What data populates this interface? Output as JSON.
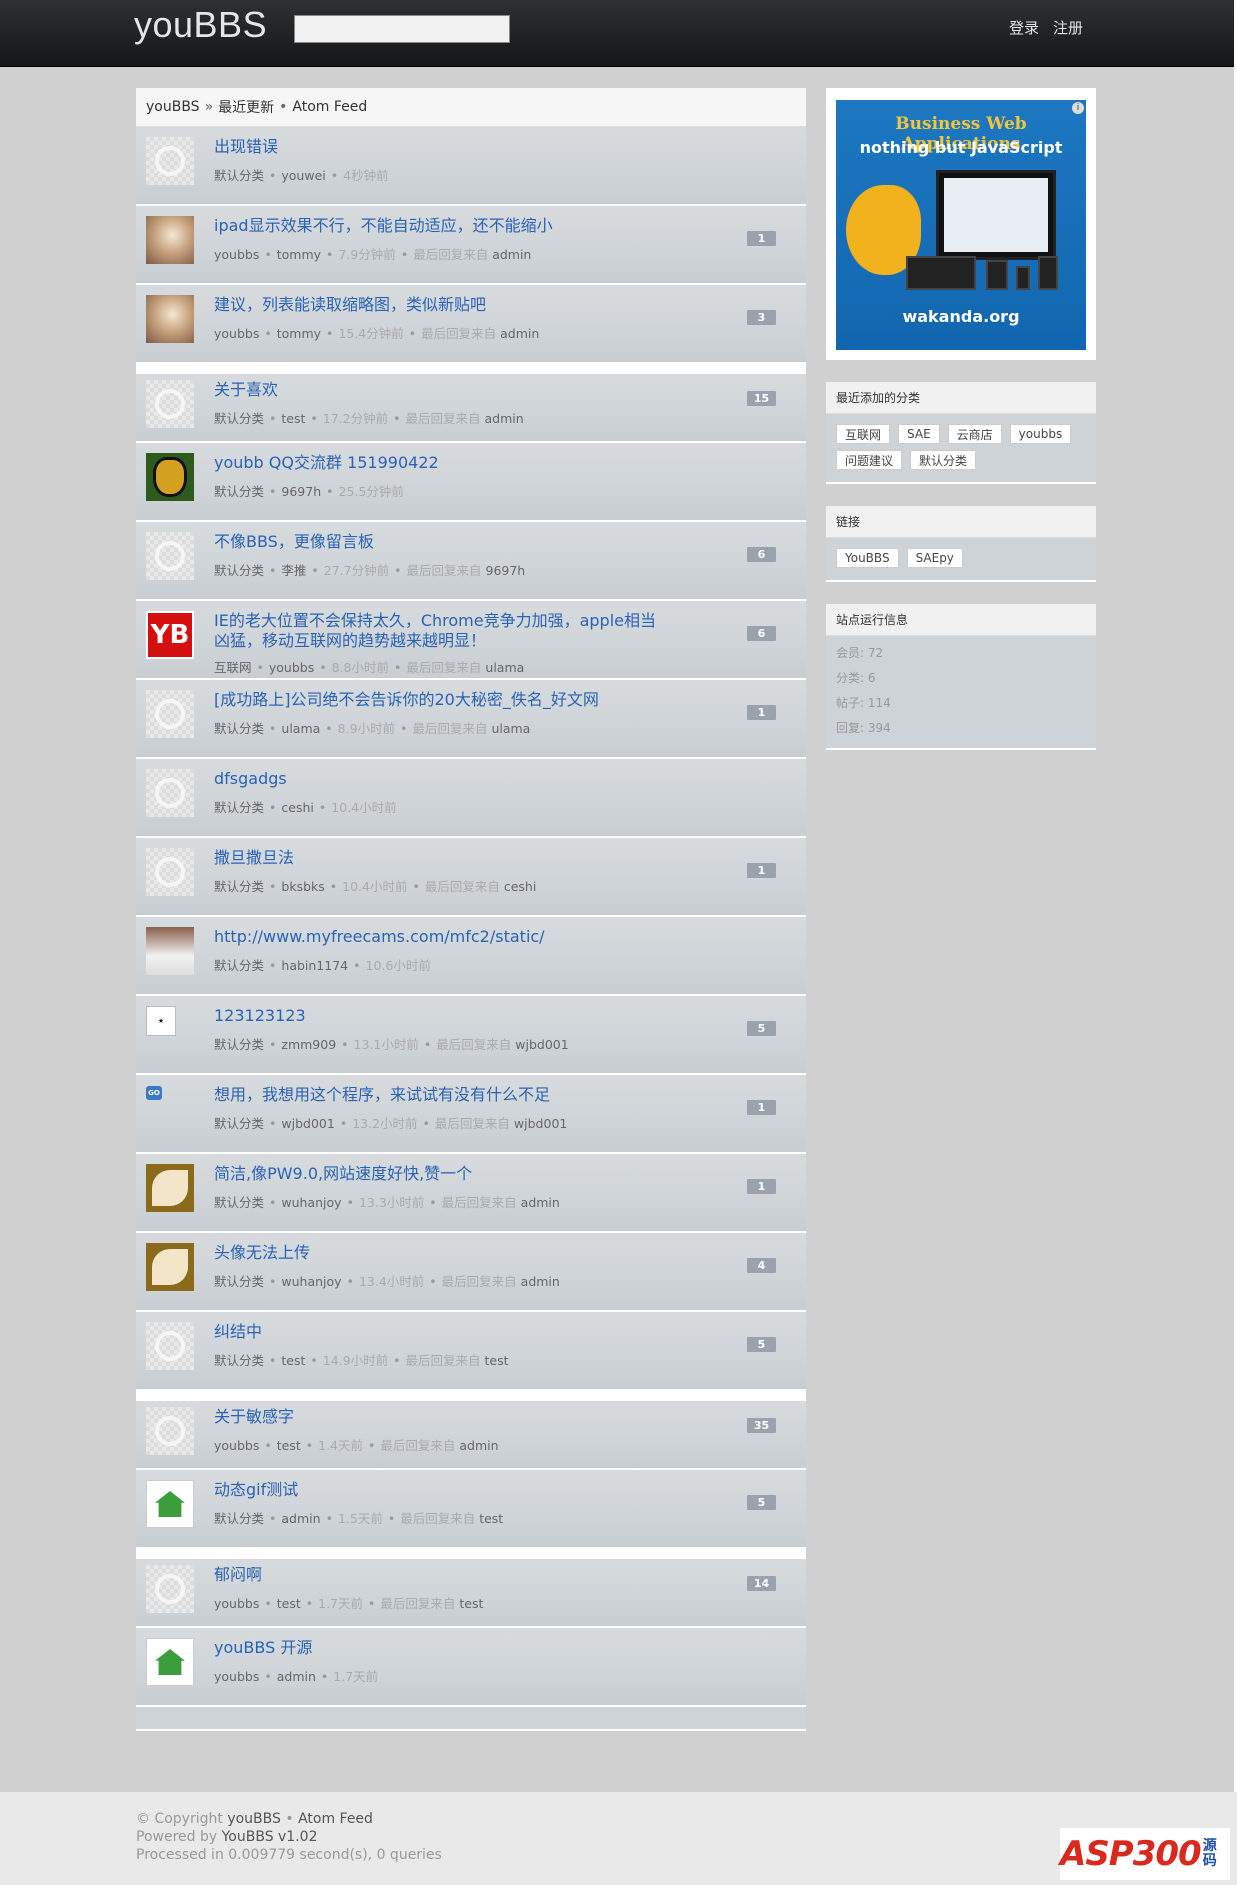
{
  "header": {
    "logo": "youBBS",
    "nav": [
      "登录",
      "注册"
    ]
  },
  "breadcrumb": {
    "home": "youBBS",
    "separator": "»",
    "current": "最近更新",
    "bullet": "•",
    "feed": "Atom Feed"
  },
  "labels": {
    "last_reply": "最后回复来自"
  },
  "topics": [
    {
      "title": "出现错误",
      "category": "默认分类",
      "author": "youwei",
      "time": "4秒钟前",
      "avatar": "default"
    },
    {
      "title": "ipad显示效果不行，不能自动适应，还不能缩小",
      "category": "youbbs",
      "author": "tommy",
      "time": "7.9分钟前",
      "last_reply": "admin",
      "count": "1",
      "avatar": "photo"
    },
    {
      "title": "建议，列表能读取缩略图，类似新贴吧",
      "category": "youbbs",
      "author": "tommy",
      "time": "15.4分钟前",
      "last_reply": "admin",
      "count": "3",
      "avatar": "photo"
    },
    {
      "title": "关于喜欢",
      "category": "默认分类",
      "author": "test",
      "time": "17.2分钟前",
      "last_reply": "admin",
      "count": "15",
      "avatar": "default",
      "sticky": true
    },
    {
      "title": "youbb QQ交流群 151990422",
      "category": "默认分类",
      "author": "9697h",
      "time": "25.5分钟前",
      "avatar": "face"
    },
    {
      "title": "不像BBS，更像留言板",
      "category": "默认分类",
      "author": "李推",
      "time": "27.7分钟前",
      "last_reply": "9697h",
      "count": "6",
      "avatar": "default"
    },
    {
      "title": "IE的老大位置不会保持太久，Chrome竞争力加强，apple相当凶猛，移动互联网的趋势越来越明显！",
      "category": "互联网",
      "author": "youbbs",
      "time": "8.8小时前",
      "last_reply": "ulama",
      "count": "6",
      "avatar": "yb",
      "twoline": true
    },
    {
      "title": "[成功路上]公司绝不会告诉你的20大秘密_佚名_好文网",
      "category": "默认分类",
      "author": "ulama",
      "time": "8.9小时前",
      "last_reply": "ulama",
      "count": "1",
      "avatar": "default"
    },
    {
      "title": "dfsgadgs",
      "category": "默认分类",
      "author": "ceshi",
      "time": "10.4小时前",
      "avatar": "default"
    },
    {
      "title": "撒旦撒旦法",
      "category": "默认分类",
      "author": "bksbks",
      "time": "10.4小时前",
      "last_reply": "ceshi",
      "count": "1",
      "avatar": "default"
    },
    {
      "title": "http://www.myfreecams.com/mfc2/static/",
      "category": "默认分类",
      "author": "habin1174",
      "time": "10.6小时前",
      "avatar": "bust"
    },
    {
      "title": "123123123",
      "category": "默认分类",
      "author": "zmm909",
      "time": "13.1小时前",
      "last_reply": "wjbd001",
      "count": "5",
      "avatar": "small"
    },
    {
      "title": "想用，我想用这个程序，来试试有没有什么不足",
      "category": "默认分类",
      "author": "wjbd001",
      "time": "13.2小时前",
      "last_reply": "wjbd001",
      "count": "1",
      "avatar": "go"
    },
    {
      "title": "简洁,像PW9.0,网站速度好快,赞一个",
      "category": "默认分类",
      "author": "wuhanjoy",
      "time": "13.3小时前",
      "last_reply": "admin",
      "count": "1",
      "avatar": "leaf"
    },
    {
      "title": "头像无法上传",
      "category": "默认分类",
      "author": "wuhanjoy",
      "time": "13.4小时前",
      "last_reply": "admin",
      "count": "4",
      "avatar": "leaf"
    },
    {
      "title": "纠结中",
      "category": "默认分类",
      "author": "test",
      "time": "14.9小时前",
      "last_reply": "test",
      "count": "5",
      "avatar": "default"
    },
    {
      "title": "关于敏感字",
      "category": "youbbs",
      "author": "test",
      "time": "1.4天前",
      "last_reply": "admin",
      "count": "35",
      "avatar": "default",
      "sticky": true
    },
    {
      "title": "动态gif测试",
      "category": "默认分类",
      "author": "admin",
      "time": "1.5天前",
      "last_reply": "test",
      "count": "5",
      "avatar": "house"
    },
    {
      "title": "郁闷啊",
      "category": "youbbs",
      "author": "test",
      "time": "1.7天前",
      "last_reply": "test",
      "count": "14",
      "avatar": "default",
      "sticky": true
    },
    {
      "title": "youBBS 开源",
      "category": "youbbs",
      "author": "admin",
      "time": "1.7天前",
      "avatar": "house"
    }
  ],
  "ad": {
    "line1": "Business Web Applications",
    "line2": "nothing but JavaScript",
    "site": "wakanda.org",
    "info": "i"
  },
  "sidebar": {
    "categories_title": "最近添加的分类",
    "categories": [
      "互联网",
      "SAE",
      "云商店",
      "youbbs",
      "问题建议",
      "默认分类"
    ],
    "links_title": "链接",
    "links": [
      "YouBBS",
      "SAEpy"
    ],
    "stats_title": "站点运行信息",
    "stats": [
      "会员: 72",
      "分类: 6",
      "帖子: 114",
      "回复: 394"
    ]
  },
  "footer": {
    "copyright_prefix": "© Copyright ",
    "copyright_name": "youBBS",
    "copyright_sep": " • ",
    "copyright_feed": "Atom Feed",
    "powered_prefix": "Powered by ",
    "powered_name": "YouBBS v1.02",
    "processed": "Processed in 0.009779 second(s), 0 queries",
    "brand_main": "ASP300",
    "brand_side": "源码"
  }
}
